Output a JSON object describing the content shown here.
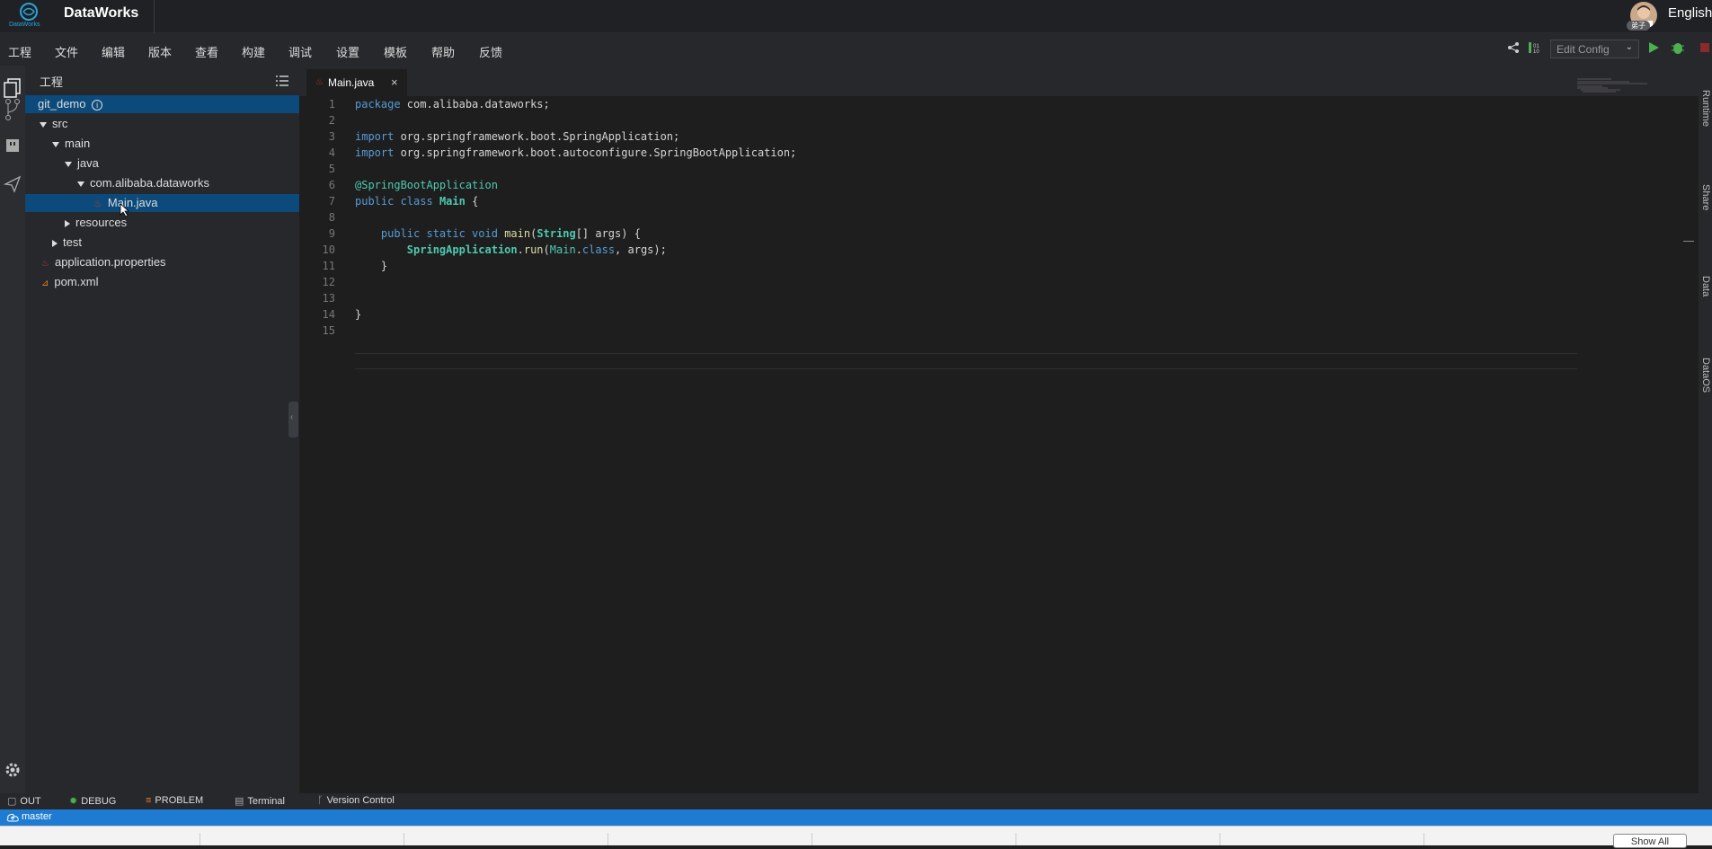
{
  "app": {
    "brand": "DataWorks",
    "logo_text": "DataWorks",
    "language": "English",
    "avatar_badge": "弟子"
  },
  "menu": [
    "工程",
    "文件",
    "编辑",
    "版本",
    "查看",
    "构建",
    "调试",
    "设置",
    "模板",
    "帮助",
    "反馈"
  ],
  "toolbar": {
    "edit_config": "Edit Config"
  },
  "sidebar": {
    "title": "工程",
    "project": "git_demo",
    "tree": [
      "src",
      "main",
      "java",
      "com.alibaba.dataworks",
      "Main.java",
      "resources",
      "test",
      "application.properties",
      "pom.xml"
    ]
  },
  "editor": {
    "tab": "Main.java",
    "line_numbers": [
      "1",
      "2",
      "3",
      "4",
      "5",
      "6",
      "7",
      "8",
      "9",
      "10",
      "11",
      "12",
      "13",
      "14",
      "15"
    ]
  },
  "right_panel": [
    "Runtime",
    "Share",
    "Data",
    "DataOS"
  ],
  "bottom_tabs": [
    "OUT",
    "DEBUG",
    "PROBLEM",
    "Terminal",
    "Version Control"
  ],
  "status": {
    "branch": "master"
  },
  "downloads": {
    "show_all": "Show All"
  }
}
